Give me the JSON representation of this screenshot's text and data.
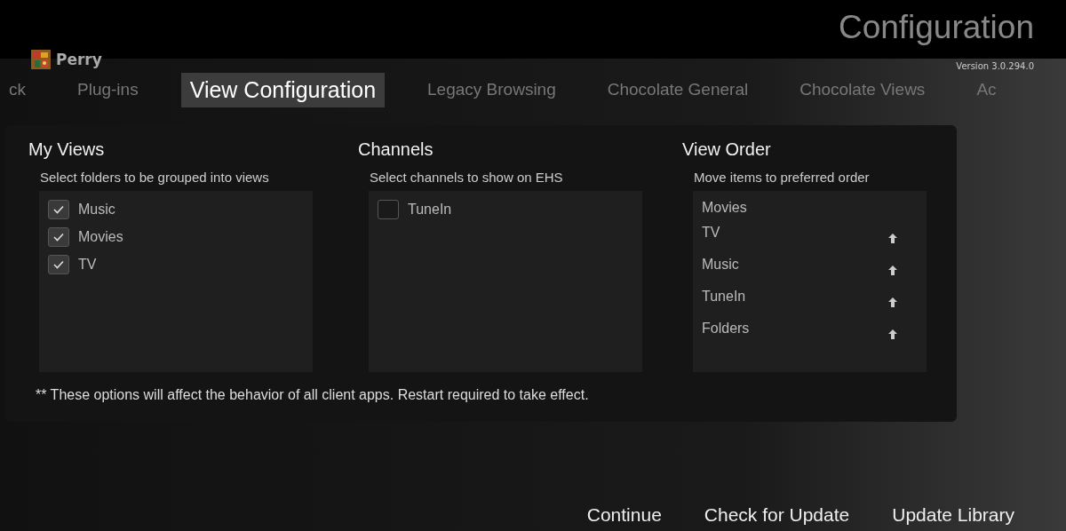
{
  "header": {
    "title": "Configuration",
    "version": "Version 3.0.294.0",
    "user": {
      "name": "Perry"
    }
  },
  "tabs": [
    {
      "label": "ck",
      "selected": false
    },
    {
      "label": "Plug-ins",
      "selected": false
    },
    {
      "label": "View Configuration",
      "selected": true
    },
    {
      "label": "Legacy Browsing",
      "selected": false
    },
    {
      "label": "Chocolate General",
      "selected": false
    },
    {
      "label": "Chocolate Views",
      "selected": false
    },
    {
      "label": "Ac",
      "selected": false
    }
  ],
  "sections": [
    {
      "kind": "checklist",
      "title": "My Views",
      "hint": "Select folders to be grouped into views",
      "items": [
        {
          "label": "Music",
          "checked": true
        },
        {
          "label": "Movies",
          "checked": true
        },
        {
          "label": "TV",
          "checked": true
        }
      ]
    },
    {
      "kind": "checklist",
      "title": "Channels",
      "hint": "Select channels to show on EHS",
      "items": [
        {
          "label": "TuneIn",
          "checked": false
        }
      ]
    },
    {
      "kind": "order",
      "title": "View Order",
      "hint": "Move items to preferred order",
      "items": [
        {
          "label": "Movies",
          "movable": false
        },
        {
          "label": "TV",
          "movable": true
        },
        {
          "label": "Music",
          "movable": true
        },
        {
          "label": "TuneIn",
          "movable": true
        },
        {
          "label": "Folders",
          "movable": true
        }
      ]
    }
  ],
  "note": "** These options will affect the behavior of all client apps.  Restart required to take effect.",
  "buttons": [
    "Continue",
    "Check for Update",
    "Update Library"
  ]
}
